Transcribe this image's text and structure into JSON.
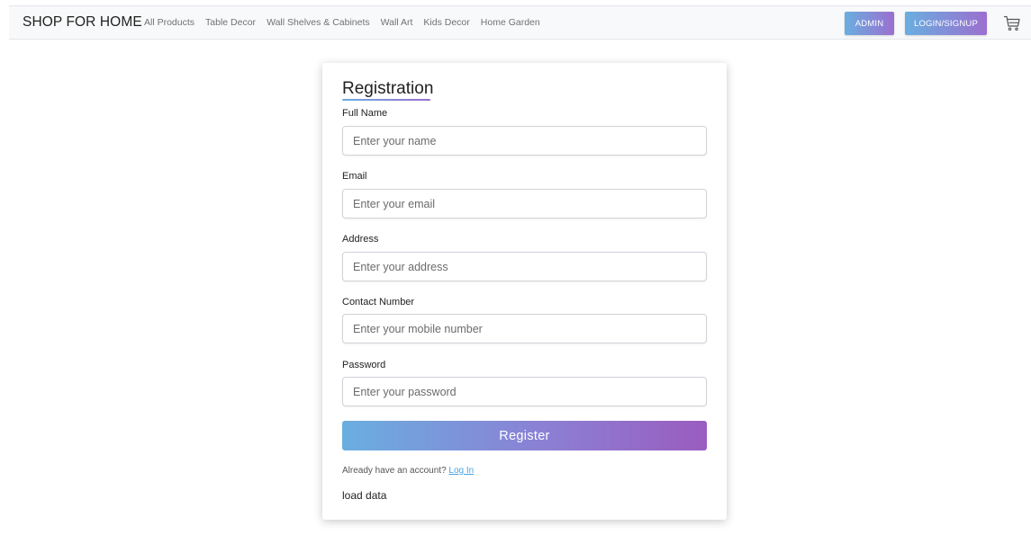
{
  "navbar": {
    "brand": "SHOP FOR HOME",
    "links": [
      "All Products",
      "Table Decor",
      "Wall Shelves & Cabinets",
      "Wall Art",
      "Kids Decor",
      "Home Garden"
    ],
    "admin_label": "ADMIN",
    "login_label": "LOGIN/SIGNUP",
    "cart_icon": "cart-icon"
  },
  "form": {
    "title": "Registration",
    "fields": [
      {
        "label": "Full Name",
        "placeholder": "Enter your name"
      },
      {
        "label": "Email",
        "placeholder": "Enter your email"
      },
      {
        "label": "Address",
        "placeholder": "Enter your address"
      },
      {
        "label": "Contact Number",
        "placeholder": "Enter your mobile number"
      },
      {
        "label": "Password",
        "placeholder": "Enter your password"
      }
    ],
    "register_label": "Register",
    "account_prompt": "Already have an account?",
    "login_link": "Log In",
    "load_data": "load data"
  },
  "colors": {
    "gradient_start": "#6aaee0",
    "gradient_end": "#9a5cc0",
    "link": "#4aa3df"
  }
}
